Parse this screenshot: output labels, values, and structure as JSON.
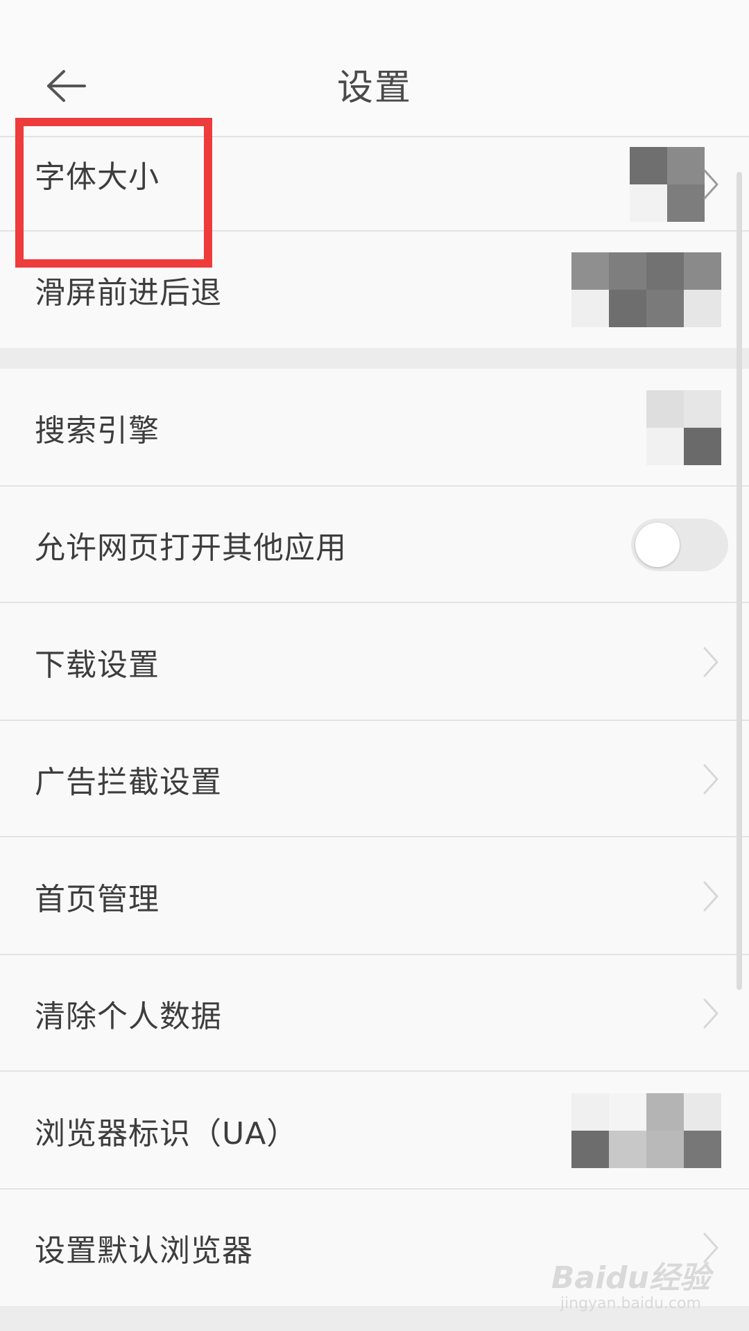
{
  "header": {
    "title": "设置",
    "back_icon": "arrow-left-icon"
  },
  "settings_group_1": {
    "items": [
      {
        "label": "字体大小",
        "icon": "chevron-right-icon"
      },
      {
        "label": "滑屏前进后退",
        "control": "toggle"
      }
    ]
  },
  "settings_group_2": {
    "items": [
      {
        "label": "搜索引擎",
        "icon": "chevron-right-icon"
      },
      {
        "label": "允许网页打开其他应用",
        "control": "toggle"
      },
      {
        "label": "下载设置",
        "icon": "chevron-right-icon"
      },
      {
        "label": "广告拦截设置",
        "icon": "chevron-right-icon"
      },
      {
        "label": "首页管理",
        "icon": "chevron-right-icon"
      },
      {
        "label": "清除个人数据",
        "icon": "chevron-right-icon"
      },
      {
        "label": "浏览器标识（UA）",
        "icon": "chevron-right-icon"
      },
      {
        "label": "设置默认浏览器",
        "icon": "chevron-right-icon"
      }
    ]
  },
  "annotation": {
    "color": "#ee3b3b"
  },
  "watermark": {
    "logo": "Baidu经验",
    "url": "jingyan.baidu.com"
  }
}
